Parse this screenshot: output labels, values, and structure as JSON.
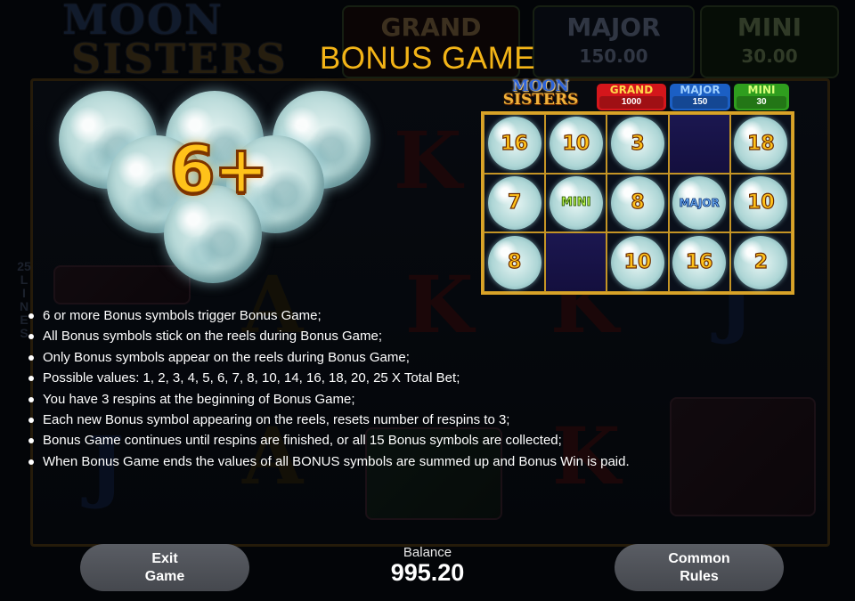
{
  "title": "BONUS GAME",
  "background": {
    "logo": [
      "MOON",
      "SISTERS"
    ],
    "jackpots": [
      {
        "name": "GRAND",
        "value": ""
      },
      {
        "name": "MAJOR",
        "value": "150.00"
      },
      {
        "name": "MINI",
        "value": "30.00"
      }
    ],
    "lines_label": [
      "25",
      "L",
      "I",
      "N",
      "E",
      "S"
    ],
    "symbols": [
      "K",
      "K",
      "K",
      "A",
      "K",
      "K",
      "J",
      "J",
      "A",
      "A"
    ]
  },
  "trigger_badge": "6+",
  "mini_board": {
    "logo": [
      "MOON",
      "SISTERS"
    ],
    "jackpots": [
      {
        "name": "GRAND",
        "value": "1000",
        "color": "#d4161b"
      },
      {
        "name": "MAJOR",
        "value": "150",
        "color": "#1b5fc4"
      },
      {
        "name": "MINI",
        "value": "30",
        "color": "#2f9e1e"
      }
    ],
    "rows": [
      [
        "16",
        "10",
        "3",
        "",
        "18"
      ],
      [
        "7",
        "MINI",
        "8",
        "MAJOR",
        "10"
      ],
      [
        "8",
        "",
        "10",
        "16",
        "2"
      ]
    ]
  },
  "rules": [
    "6 or more Bonus symbols trigger Bonus Game;",
    "All Bonus symbols stick on the reels during Bonus Game;",
    "Only Bonus symbols appear on the reels during Bonus Game;",
    "Possible values: 1, 2, 3, 4, 5, 6, 7, 8, 10, 14, 16, 18, 20, 25 X Total Bet;",
    "You have 3 respins at the beginning of Bonus Game;",
    "Each new Bonus symbol appearing on the reels, resets number of respins to 3;",
    "Bonus Game continues until respins are finished, or all 15 Bonus symbols are collected;",
    "When Bonus Game ends the values of all BONUS symbols are summed up and Bonus Win is paid."
  ],
  "footer": {
    "exit_button": [
      "Exit",
      "Game"
    ],
    "balance_label": "Balance",
    "balance_value": "995.20",
    "rules_button": [
      "Common",
      "Rules"
    ]
  }
}
